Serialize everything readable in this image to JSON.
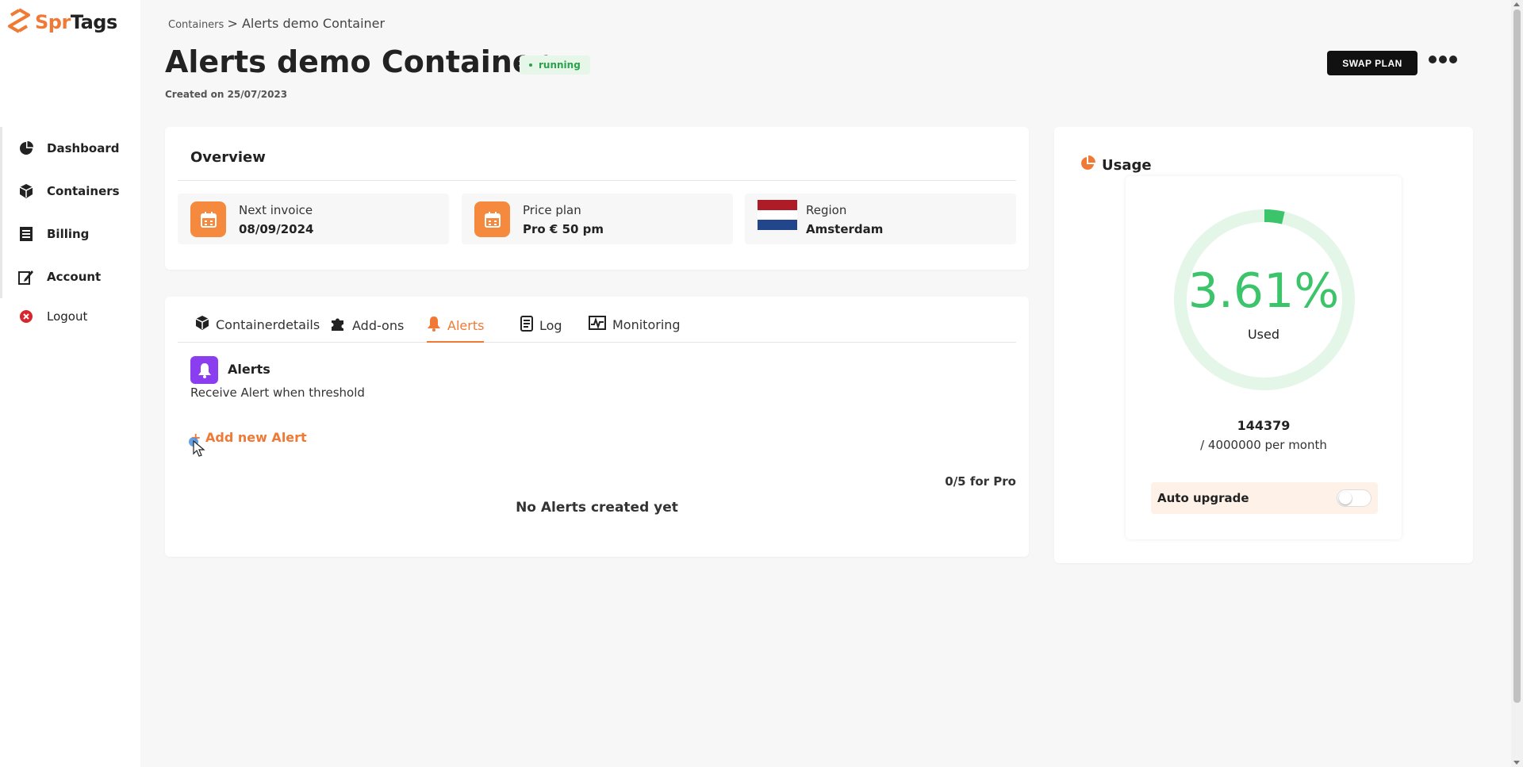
{
  "brand": {
    "prefix": "Spr",
    "suffix": "Tags",
    "accent": "#f07a35"
  },
  "sidebar": {
    "items": [
      {
        "label": "Dashboard",
        "icon": "pie-chart-icon"
      },
      {
        "label": "Containers",
        "icon": "cubes-icon"
      },
      {
        "label": "Billing",
        "icon": "receipt-icon"
      },
      {
        "label": "Account",
        "icon": "edit-icon"
      },
      {
        "label": "Logout",
        "icon": "close-circle-icon"
      }
    ]
  },
  "breadcrumb": {
    "root": "Containers",
    "current": "> Alerts demo Container"
  },
  "header": {
    "title": "Alerts demo Container",
    "status": "running",
    "created": "Created on 25/07/2023",
    "swap_label": "SWAP PLAN"
  },
  "overview": {
    "title": "Overview",
    "items": [
      {
        "label": "Next invoice",
        "value": "08/09/2024",
        "icon": "calendar-icon"
      },
      {
        "label": "Price plan",
        "value": "Pro € 50 pm",
        "icon": "calendar-icon"
      },
      {
        "label": "Region",
        "value": "Amsterdam",
        "icon": "netherlands-flag-icon"
      }
    ]
  },
  "tabs": [
    {
      "label": "Containerdetails",
      "icon": "cube-icon",
      "active": false
    },
    {
      "label": "Add-ons",
      "icon": "puzzle-icon",
      "active": false
    },
    {
      "label": "Alerts",
      "icon": "bell-icon",
      "active": true
    },
    {
      "label": "Log",
      "icon": "scroll-icon",
      "active": false
    },
    {
      "label": "Monitoring",
      "icon": "chart-line-icon",
      "active": false
    }
  ],
  "alerts": {
    "title": "Alerts",
    "description": "Receive Alert when threshold",
    "add_label": "+ Add new Alert",
    "count": "0/5 for Pro",
    "empty": "No Alerts created yet"
  },
  "usage": {
    "title": "Usage",
    "percent_label": "3.61%",
    "percent_value": 3.61,
    "used_label": "Used",
    "used_count": "144379",
    "total": "/ 4000000 per month",
    "auto_upgrade_label": "Auto upgrade",
    "auto_upgrade_on": false,
    "colors": {
      "arc": "#3cc46b",
      "track": "#e3f6e8"
    }
  }
}
